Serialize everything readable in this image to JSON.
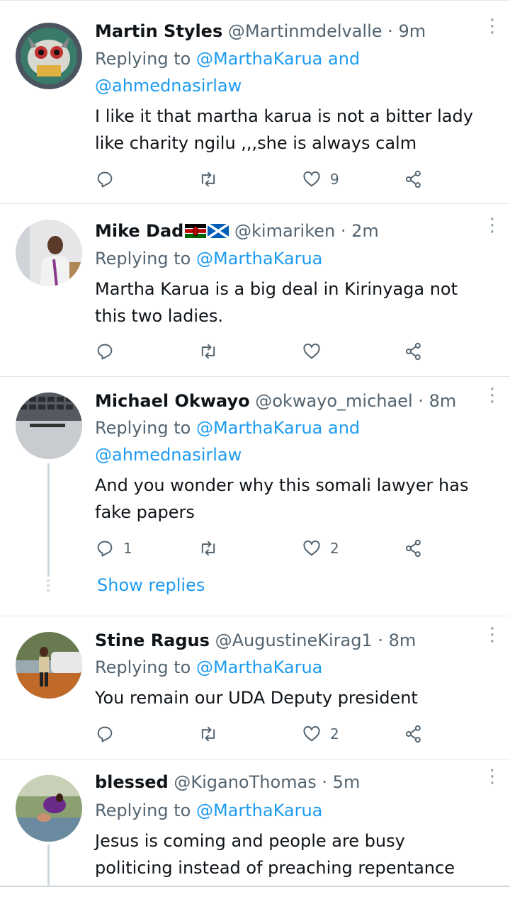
{
  "tweets": [
    {
      "name": "Martin Styles",
      "handle": "@Martinmdelvalle",
      "dot": "·",
      "time": "9m",
      "replying_prefix": "Replying to",
      "mention_line1": "@MarthaKarua and",
      "mention_line2": "@ahmednasirlaw",
      "text_line1": "I like it that martha karua is not a bitter lady",
      "text_line2": "like charity ngilu ,,,she is always calm",
      "reply_count": "",
      "retweet_count": "",
      "like_count": "9"
    },
    {
      "name": "Mike Dad",
      "handle": "@kimariken",
      "dot": "·",
      "time": "2m",
      "replying_prefix": "Replying to",
      "mention_line1": "@MarthaKarua",
      "text_line1": "Martha Karua is a big deal in Kirinyaga not",
      "text_line2": "this two ladies.",
      "reply_count": "",
      "retweet_count": "",
      "like_count": ""
    },
    {
      "name": "Michael Okwayo",
      "handle": "@okwayo_michael",
      "dot": "·",
      "time": "8m",
      "replying_prefix": "Replying to",
      "mention_line1": "@MarthaKarua and",
      "mention_line2": "@ahmednasirlaw",
      "text_line1": "And you wonder why this somali lawyer has",
      "text_line2": "fake papers",
      "reply_count": "1",
      "retweet_count": "",
      "like_count": "2",
      "show_replies": "Show replies"
    },
    {
      "name": "Stine Ragus",
      "handle": "@AugustineKirag1",
      "dot": "·",
      "time": "8m",
      "replying_prefix": "Replying to",
      "mention_line1": "@MarthaKarua",
      "text_line1": "You remain our UDA Deputy president",
      "reply_count": "",
      "retweet_count": "",
      "like_count": "2"
    },
    {
      "name": "blessed",
      "handle": "@KiganoThomas",
      "dot": "·",
      "time": "5m",
      "replying_prefix": "Replying to",
      "mention_line1": "@MarthaKarua",
      "text_line1": "Jesus is coming  and people are busy",
      "text_line2": "politicing instead of preaching repentance"
    }
  ],
  "icons": {
    "reply": "reply-icon",
    "retweet": "retweet-icon",
    "like": "heart-icon",
    "share": "share-icon",
    "more": "more-icon"
  },
  "colors": {
    "accent": "#1d9bf0",
    "secondary_text": "#536471",
    "divider": "#e1e8ed"
  }
}
